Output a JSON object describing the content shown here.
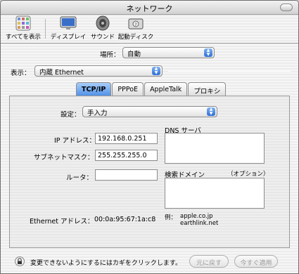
{
  "window": {
    "title": "ネットワーク"
  },
  "toolbar": {
    "show_all": "すべてを表示",
    "display": "ディスプレイ",
    "sound": "サウンド",
    "startup_disk": "起動ディスク"
  },
  "location": {
    "label": "場所：",
    "value": "自動"
  },
  "show": {
    "label": "表示：",
    "value": "内蔵 Ethernet"
  },
  "tabs": [
    {
      "label": "TCP/IP",
      "active": true
    },
    {
      "label": "PPPoE",
      "active": false
    },
    {
      "label": "AppleTalk",
      "active": false
    },
    {
      "label": "プロキシ",
      "active": false
    }
  ],
  "tcpip": {
    "config_label": "設定：",
    "config_value": "手入力",
    "ip_label": "IP アドレス：",
    "ip_value": "192.168.0.251",
    "subnet_label": "サブネットマスク：",
    "subnet_value": "255.255.255.0",
    "router_label": "ルータ：",
    "router_value": "",
    "dns_label": "DNS サーバ",
    "dns_value": "",
    "search_domain_label": "検索ドメイン",
    "optional_label": "（オプション）",
    "search_domain_value": "",
    "example_label": "例：",
    "example_values": [
      "apple.co.jp",
      "earthlink.net"
    ],
    "ethernet_label": "Ethernet アドレス：",
    "ethernet_value": "00:0a:95:67:1a:c8"
  },
  "footer": {
    "lock_text": "変更できないようにするにはカギをクリックします。",
    "revert_label": "元に戻す",
    "apply_label": "今すぐ適用"
  }
}
